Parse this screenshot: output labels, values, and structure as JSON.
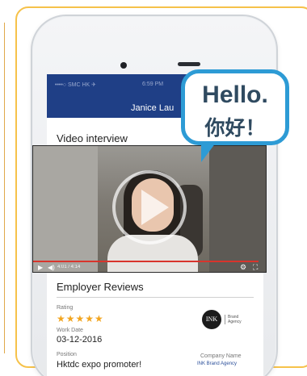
{
  "status": {
    "carrier": "••••○ SMC HK ✈",
    "time": "6:59 PM"
  },
  "header": {
    "title": "Janice Lau"
  },
  "video_section": {
    "title": "Video interview"
  },
  "video_player": {
    "time": "4:01 / 4:14",
    "progress": 0.97
  },
  "bubble": {
    "line1": "Hello.",
    "line2": "你好！"
  },
  "reviews": {
    "title": "Employer Reviews",
    "rating_label": "Rating",
    "stars": "★★★★★",
    "work_date_label": "Work Date",
    "work_date": "03-12-2016",
    "position_label": "Position",
    "position": "Hktdc expo promoter!",
    "company_label": "Company Name",
    "company": "INK Brand Agency",
    "logo_text": "INK",
    "logo_side": "Brand Agency"
  },
  "colors": {
    "nav": "#1f3f86",
    "bubble": "#2d9bd5",
    "stars": "#f2a51f",
    "frame": "#f6c24a",
    "progress": "#d8342c"
  },
  "icons": {
    "play": "play-icon",
    "volume": "volume-icon",
    "settings": "gear-icon",
    "fullscreen": "fullscreen-icon"
  }
}
